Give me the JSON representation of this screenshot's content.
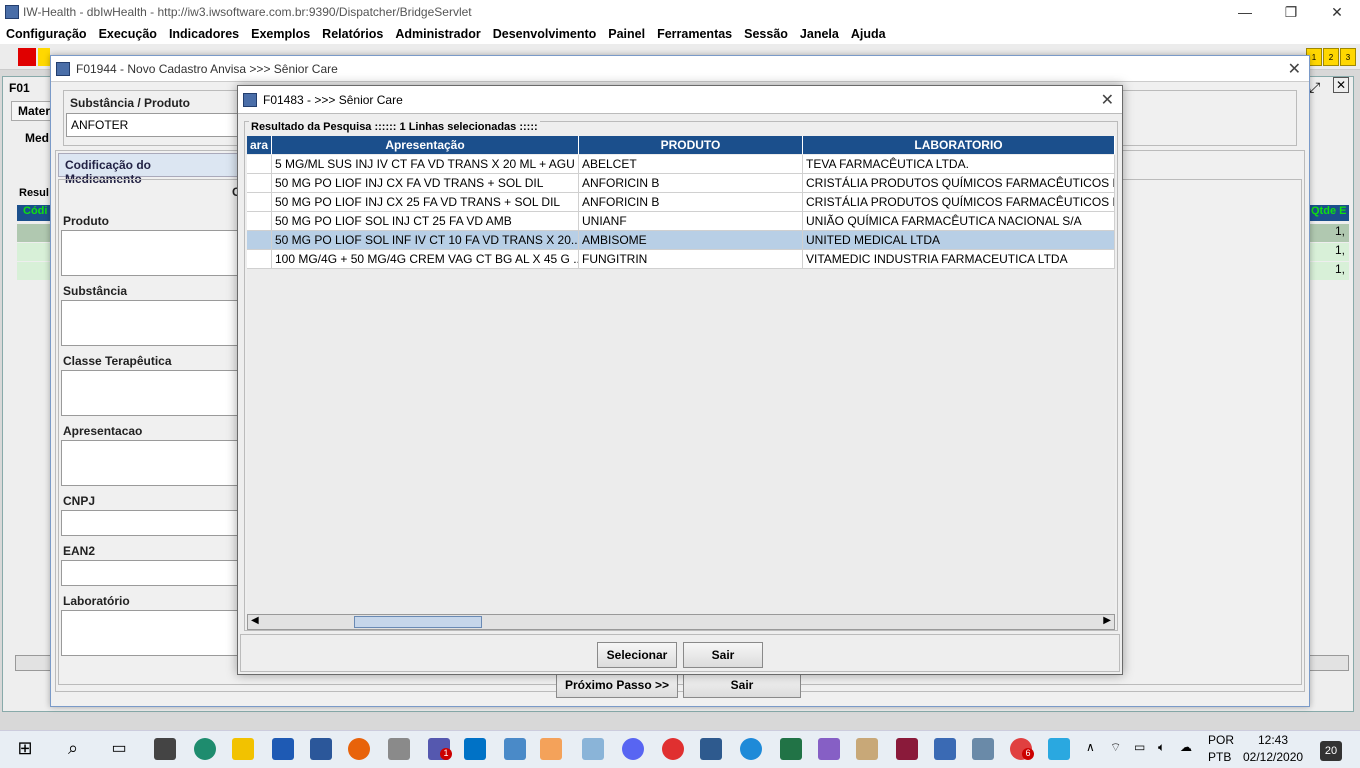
{
  "app": {
    "title": "IW-Health - dbIwHealth - http://iw3.iwsoftware.com.br:9390/Dispatcher/BridgeServlet",
    "menu": [
      "Configuração",
      "Execução",
      "Indicadores",
      "Exemplos",
      "Relatórios",
      "Administrador",
      "Desenvolvimento",
      "Painel",
      "Ferramentas",
      "Sessão",
      "Janela",
      "Ajuda"
    ],
    "toolbar_badges": [
      "1",
      "2",
      "3"
    ]
  },
  "back_window": {
    "title_fragment": "F01",
    "tab_fragment": "Mater",
    "sub_fragment": "Med",
    "result_fragment": "Resul",
    "code_fragment": "Códi",
    "qty_fragment": "Qtde E",
    "qty_values": [
      "1,",
      "1,",
      "1,"
    ]
  },
  "form_window": {
    "title": "F01944 - Novo Cadastro Anvisa >>> Sênior Care",
    "substance_label": "Substância / Produto",
    "substance_value": "ANFOTER",
    "section_title": "Codificação do Medicamento",
    "section_fragment": "C",
    "fields": [
      "Produto",
      "Substância",
      "Classe Terapêutica",
      "Apresentacao",
      "CNPJ",
      "EAN2",
      "Laboratório"
    ],
    "next_button": "Próximo Passo >>",
    "exit_button": "Sair"
  },
  "dialog": {
    "title": "F01483 -  >>> Sênior Care",
    "group_caption": "Resultado da Pesquisa :::::: 1 Linhas selecionadas :::::",
    "columns": [
      "ara",
      "Apresentação",
      "PRODUTO",
      "LABORATORIO"
    ],
    "rows": [
      {
        "apresentacao": "5 MG/ML SUS INJ IV CT FA VD TRANS X 20 ML + AGU",
        "produto": "ABELCET",
        "laboratorio": "TEVA FARMACÊUTICA LTDA.",
        "selected": false
      },
      {
        "apresentacao": "50 MG PO LIOF INJ CX FA VD TRANS + SOL DIL",
        "produto": "ANFORICIN B",
        "laboratorio": "CRISTÁLIA PRODUTOS QUÍMICOS FARMACÊUTICOS LT",
        "selected": false
      },
      {
        "apresentacao": "50 MG PO LIOF INJ CX 25 FA VD TRANS + SOL DIL",
        "produto": "ANFORICIN B",
        "laboratorio": "CRISTÁLIA PRODUTOS QUÍMICOS FARMACÊUTICOS LT",
        "selected": false
      },
      {
        "apresentacao": "50 MG PO LIOF SOL INJ CT 25 FA VD AMB",
        "produto": "UNIANF",
        "laboratorio": "UNIÃO QUÍMICA FARMACÊUTICA NACIONAL S/A",
        "selected": false
      },
      {
        "apresentacao": "50 MG PO LIOF SOL INF IV CT 10 FA VD TRANS X 20...",
        "produto": "AMBISOME",
        "laboratorio": "UNITED MEDICAL LTDA",
        "selected": true
      },
      {
        "apresentacao": "100 MG/4G + 50 MG/4G CREM VAG CT BG AL X 45 G ...",
        "produto": "FUNGITRIN",
        "laboratorio": "VITAMEDIC INDUSTRIA FARMACEUTICA LTDA",
        "selected": false
      }
    ],
    "select_button": "Selecionar",
    "exit_button": "Sair"
  },
  "taskbar": {
    "lang": "POR",
    "layout": "PTB",
    "time": "12:43",
    "date": "02/12/2020",
    "notif_count": "20",
    "badge_teams": "1",
    "badge_s": "6"
  }
}
